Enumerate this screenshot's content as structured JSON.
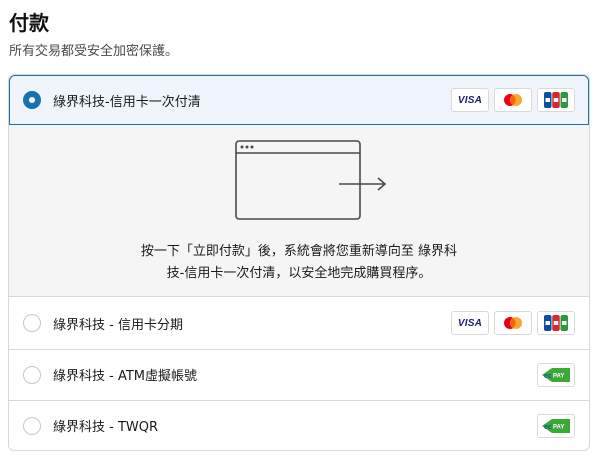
{
  "header": {
    "title": "付款",
    "subtitle": "所有交易都受安全加密保護。"
  },
  "payment_methods": [
    {
      "label": "綠界科技-信用卡一次付清",
      "selected": true,
      "logos": [
        "visa-icon",
        "mastercard-icon",
        "jcb-icon"
      ]
    },
    {
      "label": "綠界科技 - 信用卡分期",
      "selected": false,
      "logos": [
        "visa-icon",
        "mastercard-icon",
        "jcb-icon"
      ]
    },
    {
      "label": "綠界科技 - ATM虛擬帳號",
      "selected": false,
      "logos": [
        "ecpay-icon"
      ]
    },
    {
      "label": "綠界科技 - TWQR",
      "selected": false,
      "logos": [
        "ecpay-icon"
      ]
    }
  ],
  "redirect_panel": {
    "icon": "browser-redirect-icon",
    "line1": "按一下「立即付款」後，系統會將您重新導向至 綠界科",
    "line2": "技-信用卡一次付清，以安全地完成購買程序。"
  },
  "logos": {
    "visa": "VISA"
  },
  "colors": {
    "accent": "#1773b0",
    "selected_bg": "#f0f5fb",
    "panel_bg": "#f5f5f5",
    "border": "#d9d9d9",
    "mastercard_red": "#eb001b",
    "mastercard_orange": "#f79e1b",
    "ecpay_green": "#3aa935"
  }
}
